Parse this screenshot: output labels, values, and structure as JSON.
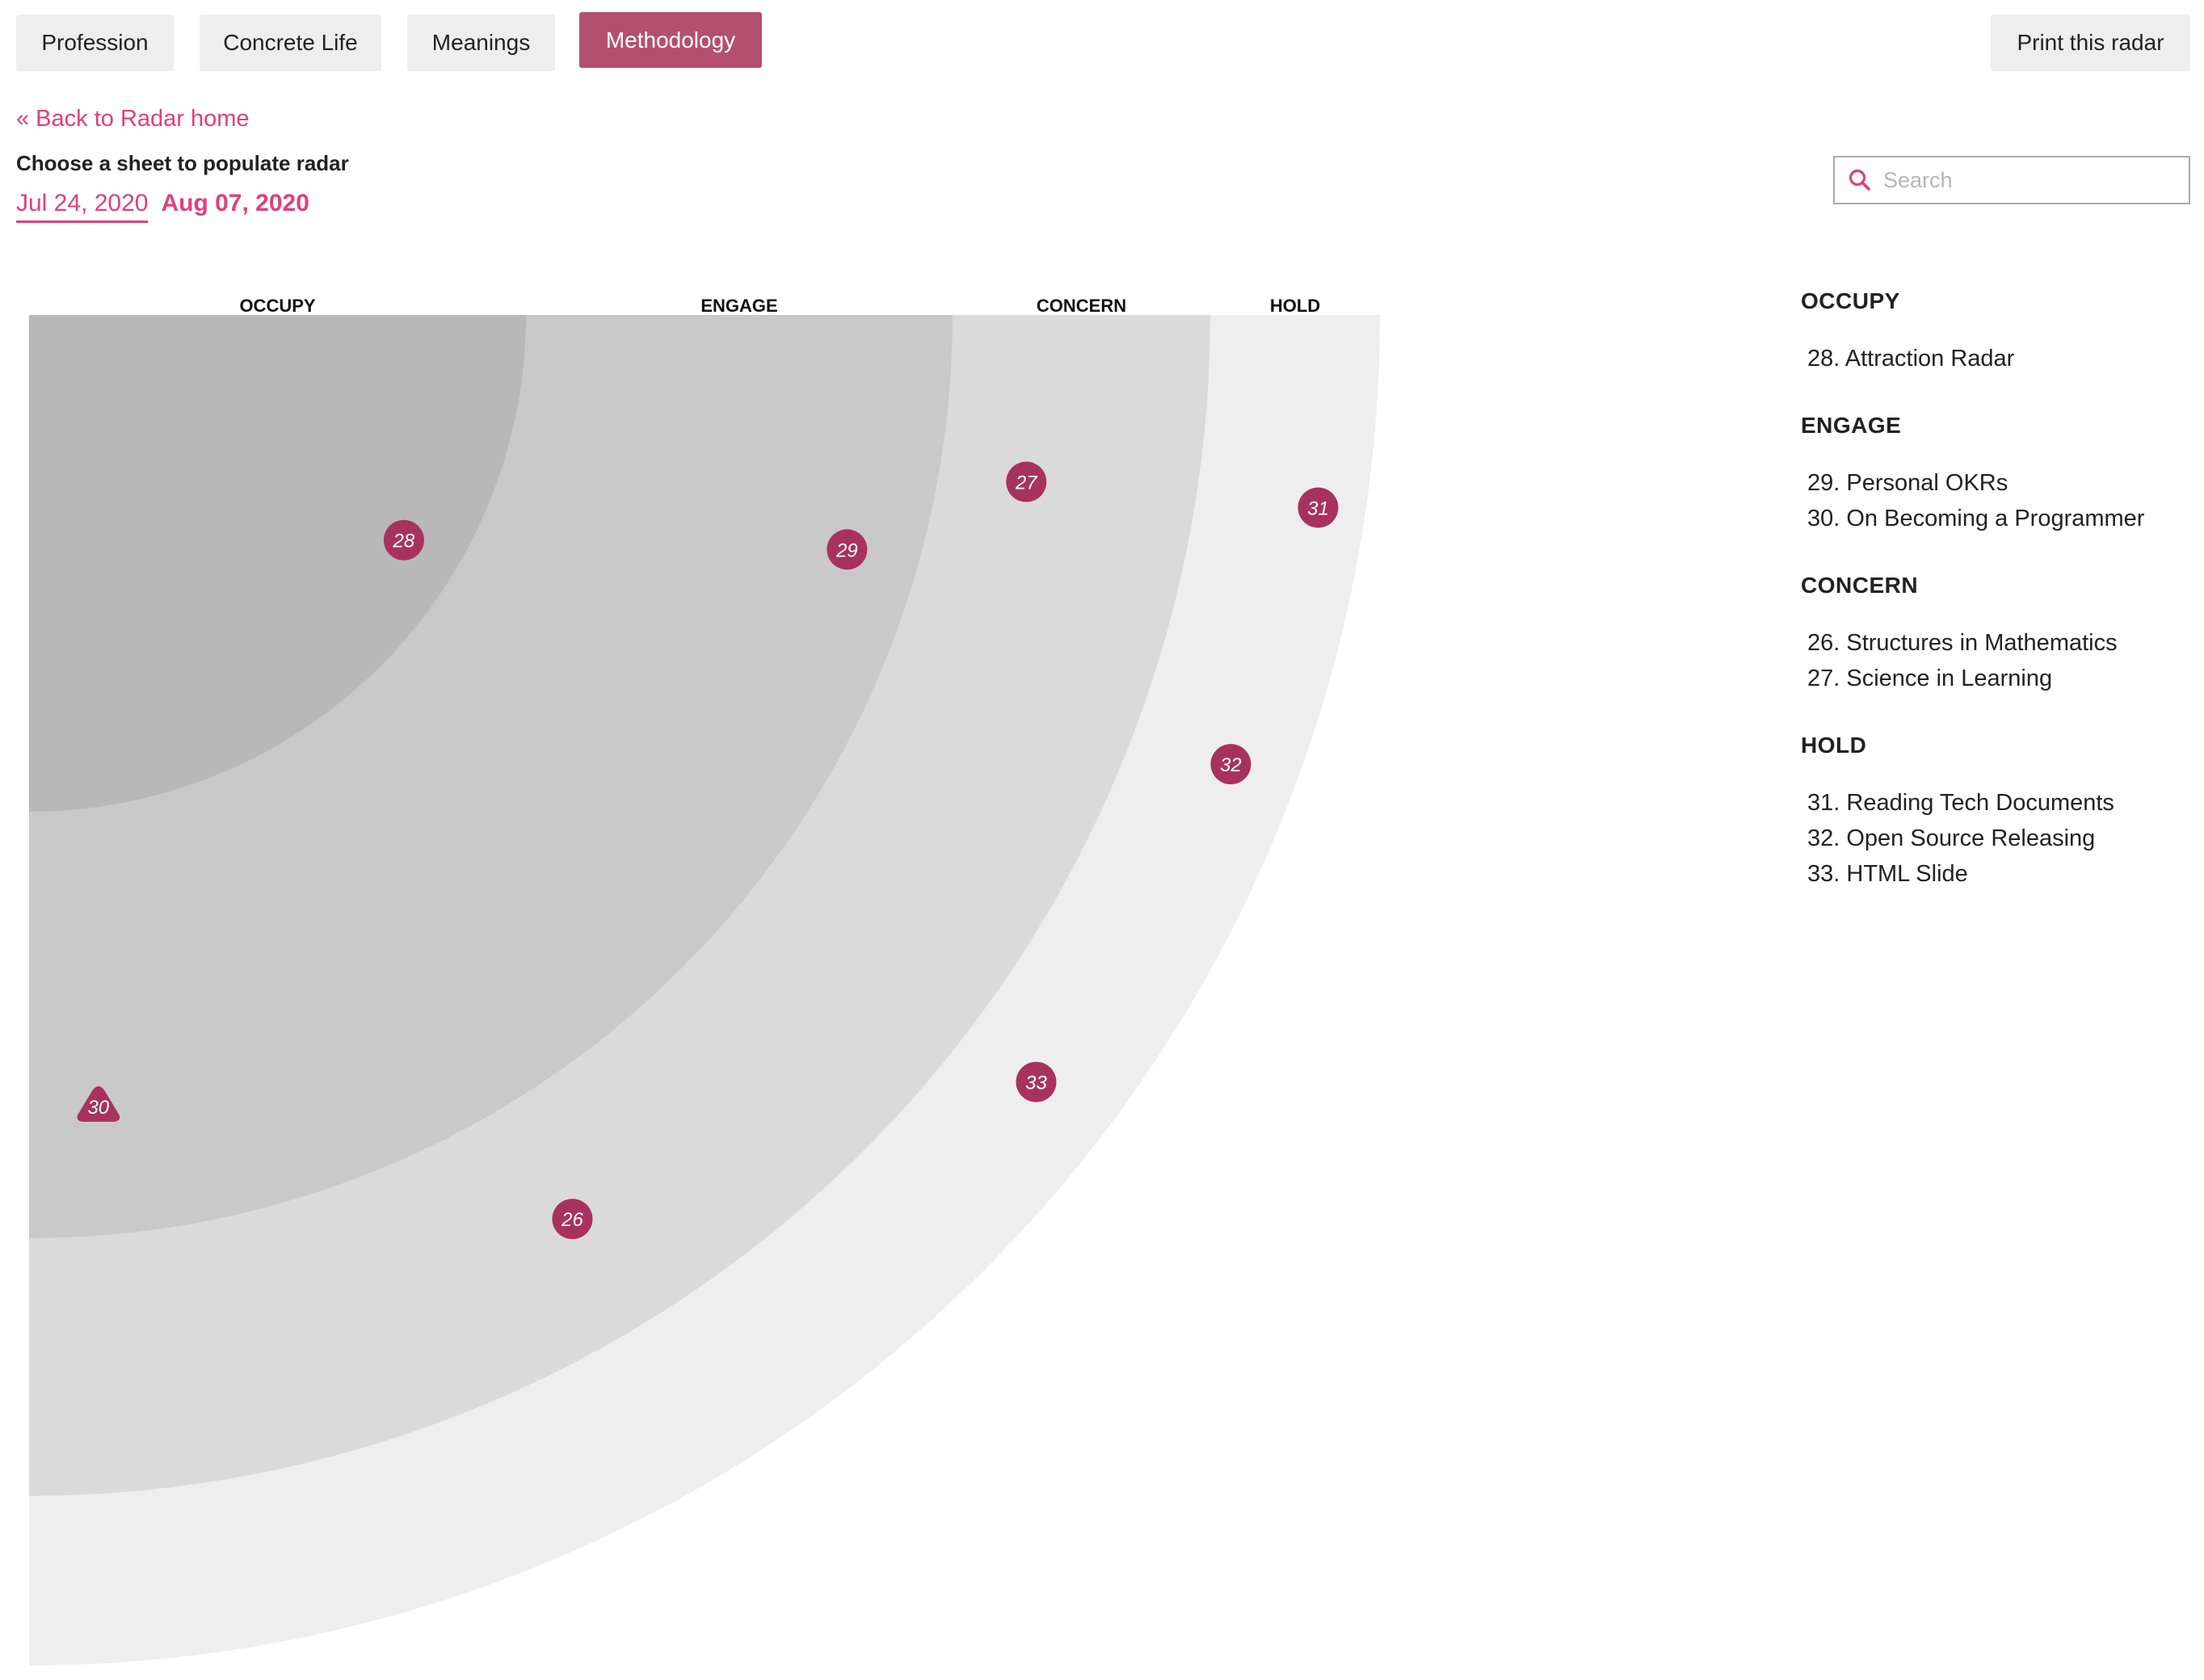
{
  "tabs": [
    {
      "label": "Profession",
      "active": false
    },
    {
      "label": "Concrete Life",
      "active": false
    },
    {
      "label": "Meanings",
      "active": false
    },
    {
      "label": "Methodology",
      "active": true
    }
  ],
  "print_button": {
    "label": "Print this radar"
  },
  "back_link": {
    "label": "« Back to Radar home"
  },
  "choose_label": "Choose a sheet to populate radar",
  "dates": [
    {
      "label": "Jul 24, 2020",
      "state": "selected"
    },
    {
      "label": "Aug 07, 2020",
      "state": "current"
    }
  ],
  "search": {
    "placeholder": "Search",
    "value": "",
    "icon": "search-icon"
  },
  "colors": {
    "accent": "#e0407a",
    "active_tab": "#b4506f",
    "blip": "#a8325e",
    "rings": [
      "#b8b8b8",
      "#c9c9c9",
      "#dadada",
      "#eeeeee"
    ]
  },
  "chart_data": {
    "type": "radar-quadrant",
    "rings": [
      "OCCUPY",
      "ENGAGE",
      "CONCERN",
      "HOLD"
    ],
    "blips": [
      {
        "id": 28,
        "name": "Attraction Radar",
        "ring": "OCCUPY",
        "shape": "circle",
        "angle_deg": 31,
        "ring_frac": 0.88
      },
      {
        "id": 29,
        "name": "Personal OKRs",
        "ring": "ENGAGE",
        "shape": "circle",
        "angle_deg": 16,
        "ring_frac": 0.83
      },
      {
        "id": 30,
        "name": "On Becoming a Programmer",
        "ring": "ENGAGE",
        "shape": "triangle",
        "angle_deg": 85,
        "ring_frac": 0.7
      },
      {
        "id": 26,
        "name": "Structures in Mathematics",
        "ring": "CONCERN",
        "shape": "circle",
        "angle_deg": 59,
        "ring_frac": 0.51
      },
      {
        "id": 27,
        "name": "Science in Learning",
        "ring": "CONCERN",
        "shape": "circle",
        "angle_deg": 9.5,
        "ring_frac": 0.34
      },
      {
        "id": 31,
        "name": "Reading Tech Documents",
        "ring": "HOLD",
        "shape": "circle",
        "angle_deg": 8.5,
        "ring_frac": 0.72
      },
      {
        "id": 32,
        "name": "Open Source Releasing",
        "ring": "HOLD",
        "shape": "circle",
        "angle_deg": 20.5,
        "ring_frac": 0.6
      },
      {
        "id": 33,
        "name": "HTML Slide",
        "ring": "HOLD",
        "shape": "circle",
        "angle_deg": 37.3,
        "ring_frac": 0.5
      }
    ]
  },
  "sidebar": {
    "sections": [
      {
        "heading": "OCCUPY",
        "items": [
          "28. Attraction Radar"
        ]
      },
      {
        "heading": "ENGAGE",
        "items": [
          "29. Personal OKRs",
          "30. On Becoming a Programmer"
        ]
      },
      {
        "heading": "CONCERN",
        "items": [
          "26. Structures in Mathematics",
          "27. Science in Learning"
        ]
      },
      {
        "heading": "HOLD",
        "items": [
          "31. Reading Tech Documents",
          "32. Open Source Releasing",
          "33. HTML Slide"
        ]
      }
    ]
  }
}
